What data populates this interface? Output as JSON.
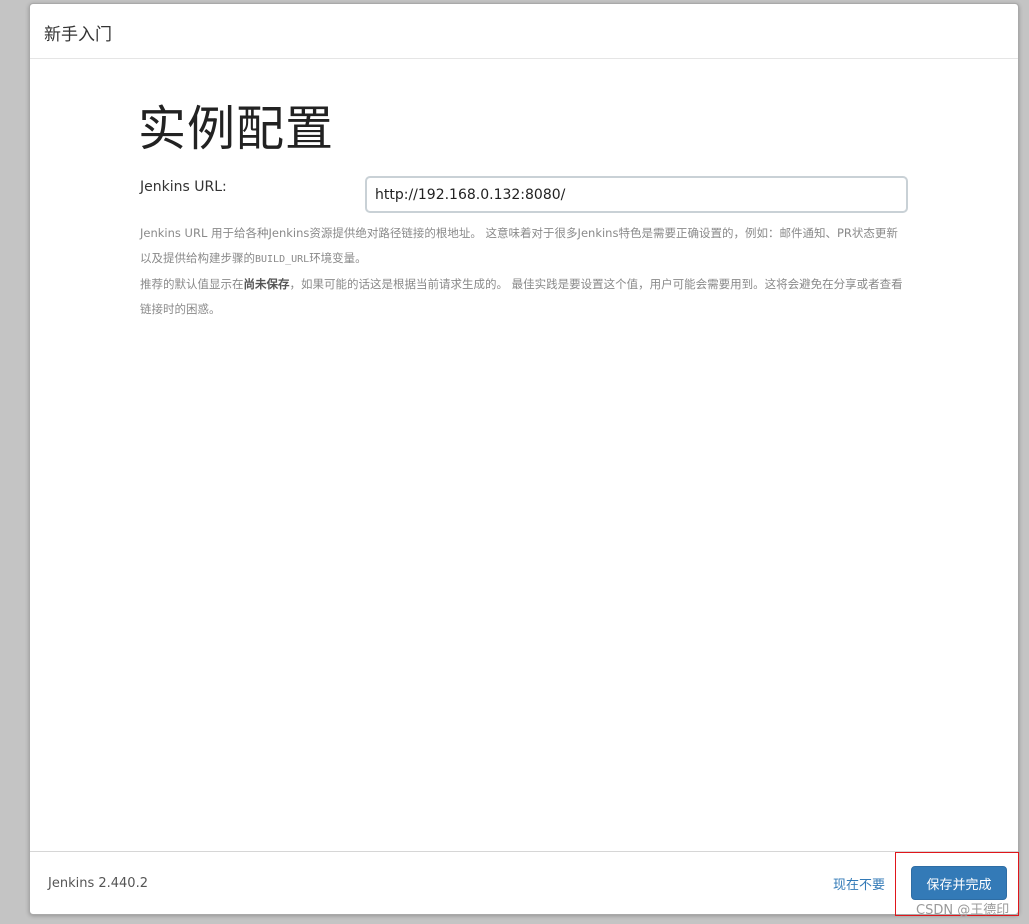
{
  "dialog": {
    "title": "新手入门"
  },
  "main": {
    "heading": "实例配置",
    "url_label": "Jenkins URL:",
    "url_value": "http://192.168.0.132:8080/",
    "help1_part1": "Jenkins URL 用于给各种Jenkins资源提供绝对路径链接的根地址。 这意味着对于很多Jenkins特色是需要正确设置的，例如：邮件通知、PR状态更新以及提供给构建步骤的",
    "help1_code": "BUILD_URL",
    "help1_part2": "环境变量。",
    "help2_part1": "推荐的默认值显示在",
    "help2_bold": "尚未保存",
    "help2_part2": "，如果可能的话这是根据当前请求生成的。 最佳实践是要设置这个值，用户可能会需要用到。这将会避免在分享或者查看链接时的困惑。"
  },
  "footer": {
    "version": "Jenkins 2.440.2",
    "skip_label": "现在不要",
    "save_label": "保存并完成"
  },
  "overlay": {
    "watermark": "CSDN @王德印",
    "highlight_color": "#e0161b"
  },
  "colors": {
    "primary": "#337ab7",
    "background": "#c4c4c4"
  }
}
